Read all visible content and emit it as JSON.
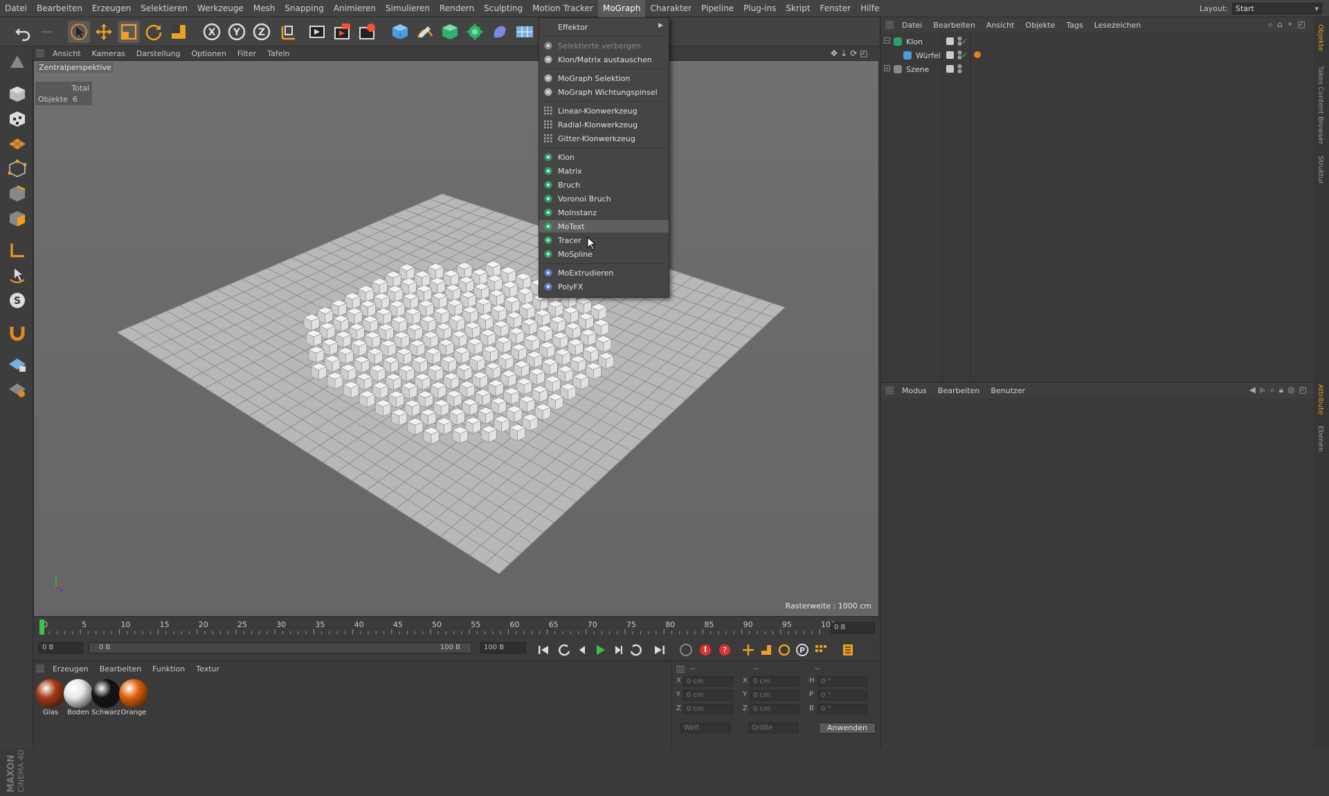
{
  "menubar": {
    "items": [
      "Datei",
      "Bearbeiten",
      "Erzeugen",
      "Selektieren",
      "Werkzeuge",
      "Mesh",
      "Snapping",
      "Animieren",
      "Simulieren",
      "Rendern",
      "Sculpting",
      "Motion Tracker",
      "MoGraph",
      "Charakter",
      "Pipeline",
      "Plug-ins",
      "Skript",
      "Fenster",
      "Hilfe"
    ],
    "active_index": 12,
    "layout_label": "Layout:",
    "layout_value": "Start"
  },
  "toolbar": {
    "icons": [
      "undo-icon",
      "redo-icon",
      "select-arrow-icon",
      "move-icon",
      "scale-icon",
      "rotate-icon",
      "scale-icon-2",
      "x-axis-icon",
      "y-axis-icon",
      "z-axis-icon",
      "coordinate-system-icon",
      "render-view-icon",
      "render-picture-queue-icon",
      "render-settings-icon",
      "cube-object-icon",
      "pen-spline-icon",
      "subdivision-generator-icon",
      "cloner-generator-icon",
      "deformer-icon",
      "floor-scene-icon"
    ]
  },
  "viewport": {
    "menu": [
      "Ansicht",
      "Kameras",
      "Darstellung",
      "Optionen",
      "Filter",
      "Tafeln"
    ],
    "camera_label": "Zentralperspektive",
    "stats_header": "Total",
    "stats_label": "Objekte",
    "stats_value": "6",
    "raster": "Rasterweite : 1000 cm"
  },
  "timeline": {
    "ticks": [
      "0",
      "5",
      "10",
      "15",
      "20",
      "25",
      "30",
      "35",
      "40",
      "45",
      "50",
      "55",
      "60",
      "65",
      "70",
      "75",
      "80",
      "85",
      "90",
      "95",
      "100"
    ],
    "end_frame": "0 B",
    "current_frame": "0 B",
    "range_start": "0 B",
    "range_end": "100 B",
    "max_frame": "100 B"
  },
  "materials": {
    "menu": [
      "Erzeugen",
      "Bearbeiten",
      "Funktion",
      "Textur"
    ],
    "items": [
      {
        "name": "Glas",
        "color": "#a83a14"
      },
      {
        "name": "Boden",
        "color": "#e8e8e8"
      },
      {
        "name": "Schwarz",
        "color": "#111111"
      },
      {
        "name": "Orange",
        "color": "#e0600a"
      }
    ]
  },
  "coords": {
    "header": [
      "--",
      "--",
      "--"
    ],
    "rows": [
      {
        "l1": "X",
        "v1": "0 cm",
        "l2": "X",
        "v2": "0 cm",
        "l3": "H",
        "v3": "0 °"
      },
      {
        "l1": "Y",
        "v1": "0 cm",
        "l2": "Y",
        "v2": "0 cm",
        "l3": "P",
        "v3": "0 °"
      },
      {
        "l1": "Z",
        "v1": "0 cm",
        "l2": "Z",
        "v2": "0 cm",
        "l3": "B",
        "v3": "0 °"
      }
    ],
    "mode1": "Welt",
    "mode2": "Größe",
    "apply": "Anwenden"
  },
  "objects": {
    "menu": [
      "Datei",
      "Bearbeiten",
      "Ansicht",
      "Objekte",
      "Tags",
      "Lesezeichen"
    ],
    "rows": [
      {
        "name": "Klon",
        "icon": "cloner-icon"
      },
      {
        "name": "Würfel",
        "icon": "cube-icon"
      },
      {
        "name": "Szene",
        "icon": "null-object-icon"
      }
    ]
  },
  "attributes": {
    "menu": [
      "Modus",
      "Bearbeiten",
      "Benutzer"
    ]
  },
  "right_tabs": [
    "Objekte",
    "Takes",
    "Content Browser",
    "Struktur",
    "Attribute",
    "Ebenen"
  ],
  "dropdown": {
    "items": [
      {
        "label": "Effektor",
        "icon": "",
        "type": "submenu"
      },
      {
        "label": "Selektierte verbergen",
        "icon": "hide-icon",
        "type": "disabled"
      },
      {
        "label": "Klon/Matrix austauschen",
        "icon": "swap-icon",
        "type": "item"
      },
      {
        "label": "MoGraph Selektion",
        "icon": "selection-icon",
        "type": "item"
      },
      {
        "label": "MoGraph Wichtungspinsel",
        "icon": "brush-icon",
        "type": "item"
      },
      {
        "label": "Linear-Klonwerkzeug",
        "icon": "linear-clone-icon",
        "type": "item"
      },
      {
        "label": "Radial-Klonwerkzeug",
        "icon": "radial-clone-icon",
        "type": "item"
      },
      {
        "label": "Gitter-Klonwerkzeug",
        "icon": "grid-clone-icon",
        "type": "item"
      },
      {
        "label": "Klon",
        "icon": "cloner-icon",
        "type": "item"
      },
      {
        "label": "Matrix",
        "icon": "matrix-icon",
        "type": "item"
      },
      {
        "label": "Bruch",
        "icon": "fracture-icon",
        "type": "item"
      },
      {
        "label": "Voronoi Bruch",
        "icon": "voronoi-icon",
        "type": "item"
      },
      {
        "label": "MoInstanz",
        "icon": "moinstance-icon",
        "type": "item"
      },
      {
        "label": "MoText",
        "icon": "motext-icon",
        "type": "highlighted"
      },
      {
        "label": "Tracer",
        "icon": "tracer-icon",
        "type": "item"
      },
      {
        "label": "MoSpline",
        "icon": "mospline-icon",
        "type": "item"
      },
      {
        "label": "MoExtrudieren",
        "icon": "moextrude-icon",
        "type": "item"
      },
      {
        "label": "PolyFX",
        "icon": "polyfx-icon",
        "type": "item"
      }
    ]
  },
  "colors": {
    "accent_green": "#3cc24a",
    "mograph_icon_green": "#2aa36a",
    "ui_bg": "#3a3a3a"
  }
}
